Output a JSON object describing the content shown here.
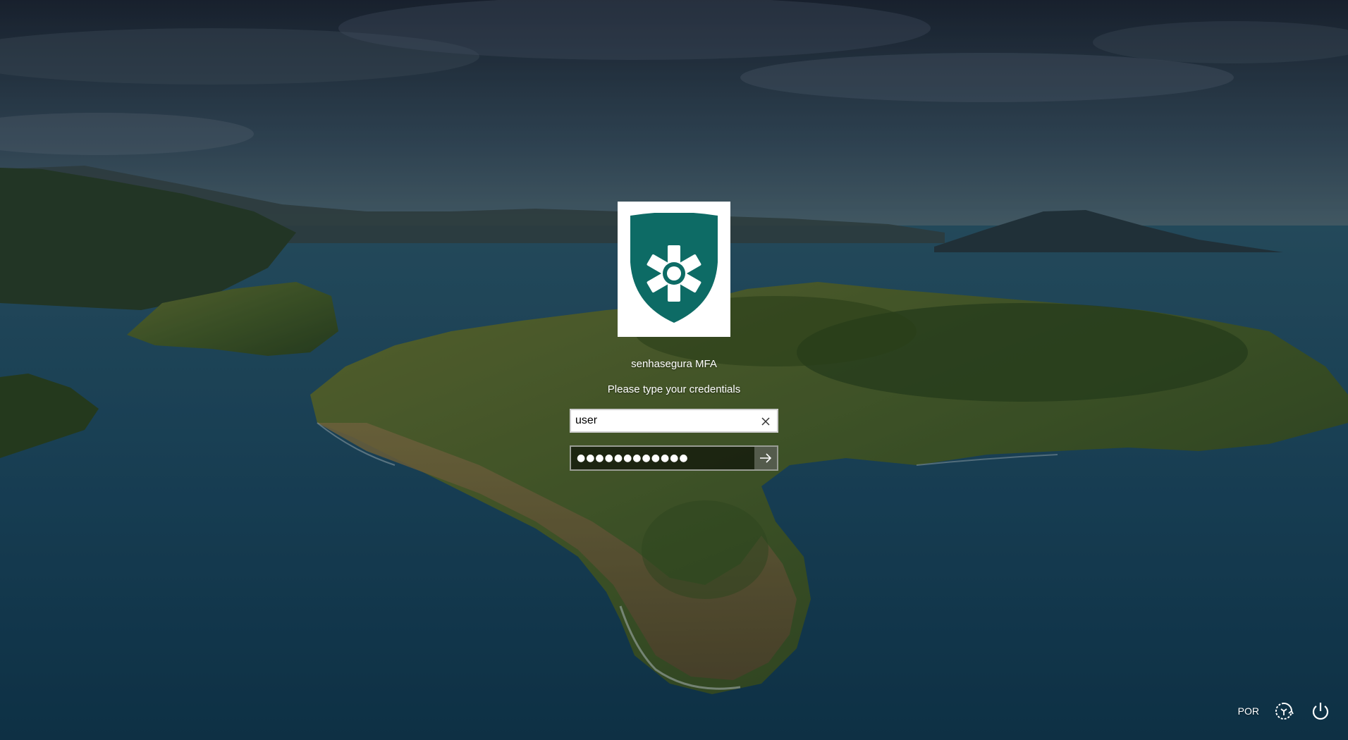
{
  "wallpaper": {
    "description_name": "coastal-peninsula-wallpaper"
  },
  "credential_provider": {
    "name": "senhasegura MFA",
    "logo_icon": "shield-asterisk-icon",
    "logo_color": "#0d6b65",
    "prompt": "Please type your credentials"
  },
  "username_field": {
    "value": "user",
    "clear_icon": "close-icon"
  },
  "password_field": {
    "masked_value": "●●●●●●●●●●●●",
    "submit_icon": "arrow-right-icon"
  },
  "tray": {
    "language": "POR",
    "accessibility_icon": "ease-of-access-icon",
    "power_icon": "power-icon"
  }
}
